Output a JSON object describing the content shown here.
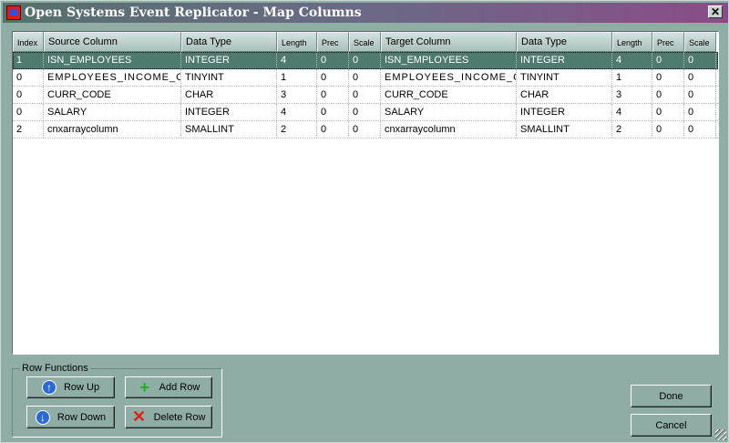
{
  "window": {
    "title": "Open Systems Event Replicator - Map Columns",
    "close": "✕"
  },
  "columns": [
    "Index",
    "Source Column",
    "Data Type",
    "Length",
    "Prec",
    "Scale",
    "Target Column",
    "Data Type",
    "Length",
    "Prec",
    "Scale"
  ],
  "rows": [
    [
      "1",
      "ISN_EMPLOYEES",
      "INTEGER",
      "4",
      "0",
      "0",
      "ISN_EMPLOYEES",
      "INTEGER",
      "4",
      "0",
      "0"
    ],
    [
      "0",
      "EMPLOYEES_INCOME_C...",
      "TINYINT",
      "1",
      "0",
      "0",
      "EMPLOYEES_INCOME_C...",
      "TINYINT",
      "1",
      "0",
      "0"
    ],
    [
      "0",
      "CURR_CODE",
      "CHAR",
      "3",
      "0",
      "0",
      "CURR_CODE",
      "CHAR",
      "3",
      "0",
      "0"
    ],
    [
      "0",
      "SALARY",
      "INTEGER",
      "4",
      "0",
      "0",
      "SALARY",
      "INTEGER",
      "4",
      "0",
      "0"
    ],
    [
      "2",
      "cnxarraycolumn",
      "SMALLINT",
      "2",
      "0",
      "0",
      "cnxarraycolumn",
      "SMALLINT",
      "2",
      "0",
      "0"
    ]
  ],
  "selected_row": 0,
  "row_functions": {
    "label": "Row Functions",
    "row_up": "Row Up",
    "add_row": "Add Row",
    "row_down": "Row Down",
    "delete_row": "Delete Row"
  },
  "done": "Done",
  "cancel": "Cancel"
}
